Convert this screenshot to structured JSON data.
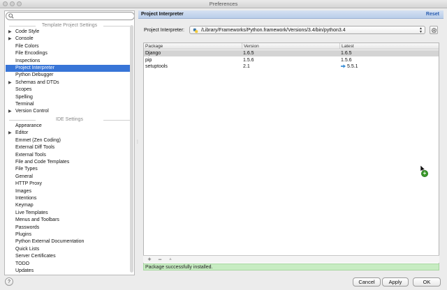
{
  "window": {
    "title": "Preferences"
  },
  "sidebar": {
    "search_value": "",
    "sections": [
      {
        "title": "Template Project Settings"
      },
      {
        "title": "IDE Settings"
      }
    ],
    "project_items": [
      {
        "label": "Code Style",
        "expandable": true
      },
      {
        "label": "Console",
        "expandable": true
      },
      {
        "label": "File Colors",
        "expandable": false
      },
      {
        "label": "File Encodings",
        "expandable": false
      },
      {
        "label": "Inspections",
        "expandable": false
      },
      {
        "label": "Project Interpreter",
        "expandable": false,
        "selected": true
      },
      {
        "label": "Python Debugger",
        "expandable": false
      },
      {
        "label": "Schemas and DTDs",
        "expandable": true
      },
      {
        "label": "Scopes",
        "expandable": false
      },
      {
        "label": "Spelling",
        "expandable": false
      },
      {
        "label": "Terminal",
        "expandable": false
      },
      {
        "label": "Version Control",
        "expandable": true
      }
    ],
    "ide_items": [
      {
        "label": "Appearance",
        "expandable": false
      },
      {
        "label": "Editor",
        "expandable": true
      },
      {
        "label": "Emmet (Zen Coding)",
        "expandable": false
      },
      {
        "label": "External Diff Tools",
        "expandable": false
      },
      {
        "label": "External Tools",
        "expandable": false
      },
      {
        "label": "File and Code Templates",
        "expandable": false
      },
      {
        "label": "File Types",
        "expandable": false
      },
      {
        "label": "General",
        "expandable": false
      },
      {
        "label": "HTTP Proxy",
        "expandable": false
      },
      {
        "label": "Images",
        "expandable": false
      },
      {
        "label": "Intentions",
        "expandable": false
      },
      {
        "label": "Keymap",
        "expandable": false
      },
      {
        "label": "Live Templates",
        "expandable": false
      },
      {
        "label": "Menus and Toolbars",
        "expandable": false
      },
      {
        "label": "Passwords",
        "expandable": false
      },
      {
        "label": "Plugins",
        "expandable": false
      },
      {
        "label": "Python External Documentation",
        "expandable": false
      },
      {
        "label": "Quick Lists",
        "expandable": false
      },
      {
        "label": "Server Certificates",
        "expandable": false
      },
      {
        "label": "TODO",
        "expandable": false
      },
      {
        "label": "Updates",
        "expandable": false
      }
    ]
  },
  "main": {
    "title": "Project Interpreter",
    "reset_label": "Reset",
    "interpreter_label": "Project Interpreter:",
    "interpreter_value": "/Library/Frameworks/Python.framework/Versions/3.4/bin/python3.4",
    "table": {
      "headers": [
        "Package",
        "Version",
        "Latest"
      ],
      "rows": [
        {
          "package": "Django",
          "version": "1.6.5",
          "latest": "1.6.5",
          "upgrade": false,
          "selected": true
        },
        {
          "package": "pip",
          "version": "1.5.6",
          "latest": "1.5.6",
          "upgrade": false,
          "selected": false
        },
        {
          "package": "setuptools",
          "version": "2.1",
          "latest": "5.5.1",
          "upgrade": true,
          "selected": false
        }
      ]
    },
    "toolbar": {
      "add": "+",
      "remove": "−",
      "upgrade": "▲"
    },
    "status": "Package successfully installed."
  },
  "buttons": {
    "help": "?",
    "cancel": "Cancel",
    "apply": "Apply",
    "ok": "OK"
  },
  "colors": {
    "selection": "#3875d7",
    "status_bg": "#c7ecc2",
    "link": "#2a5db0",
    "upgrade": "#3b8fd6"
  }
}
